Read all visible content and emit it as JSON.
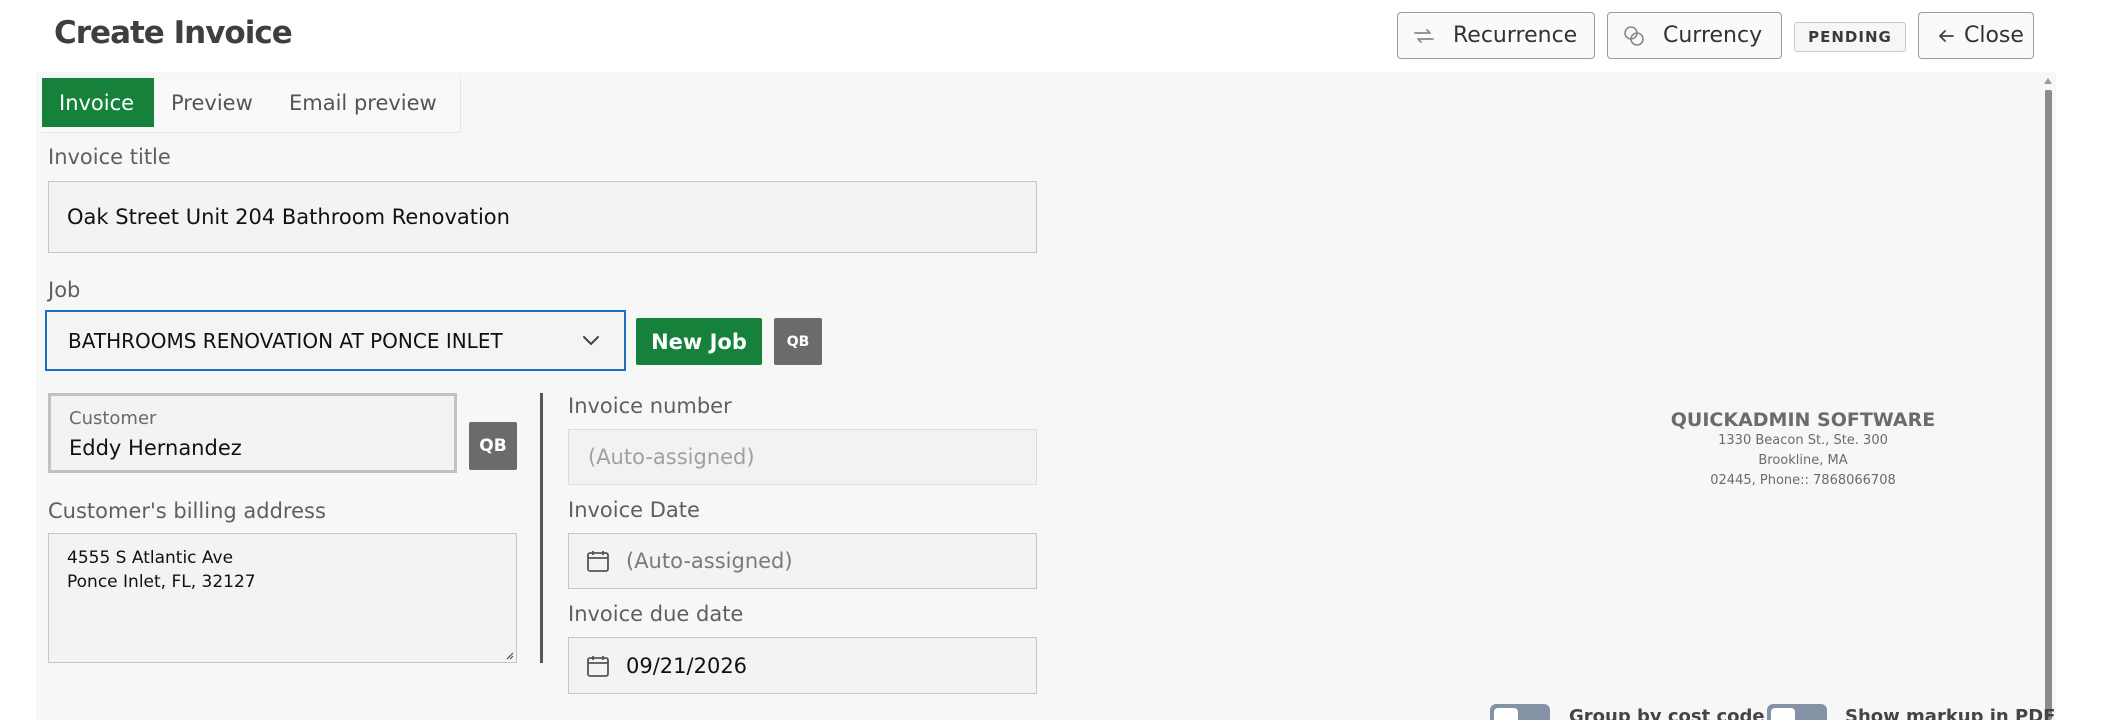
{
  "page": {
    "title": "Create Invoice"
  },
  "header": {
    "recurrence_label": "Recurrence",
    "currency_label": "Currency",
    "status_badge": "PENDING",
    "close_label": "Close"
  },
  "tabs": [
    {
      "label": "Invoice",
      "active": true
    },
    {
      "label": "Preview",
      "active": false
    },
    {
      "label": "Email preview",
      "active": false
    }
  ],
  "form": {
    "invoice_title_label": "Invoice title",
    "invoice_title_value": "Oak Street Unit 204 Bathroom Renovation",
    "job_label": "Job",
    "job_value": "BATHROOMS RENOVATION AT PONCE INLET",
    "new_job_label": "New Job",
    "qb_label": "QB",
    "customer_caption": "Customer",
    "customer_value": "Eddy Hernandez",
    "billing_label": "Customer's billing address",
    "billing_line1": "4555 S Atlantic Ave",
    "billing_line2": "Ponce Inlet, FL, 32127",
    "invoice_number_label": "Invoice number",
    "invoice_number_placeholder": "(Auto-assigned)",
    "invoice_date_label": "Invoice Date",
    "invoice_date_placeholder": "(Auto-assigned)",
    "due_date_label": "Invoice due date",
    "due_date_value": "09/21/2026"
  },
  "company": {
    "name": "QUICKADMIN SOFTWARE",
    "address1": "1330 Beacon St., Ste. 300",
    "address2": "Brookline, MA",
    "address3": "02445, Phone:: 7868066708"
  },
  "toggles": [
    {
      "label": "Group by cost code",
      "on": false
    },
    {
      "label": "Show markup in PDF",
      "on": false
    }
  ],
  "colors": {
    "accent_green": "#16813b",
    "focus_blue": "#1d70c0",
    "qb_gray": "#6b6b6b",
    "toggle_off": "#8492a6"
  },
  "icons": {
    "recurrence": "repeat-arrows-icon",
    "currency": "coins-icon",
    "close": "arrow-left-icon",
    "job_dropdown": "chevron-down-icon",
    "date": "calendar-icon"
  }
}
